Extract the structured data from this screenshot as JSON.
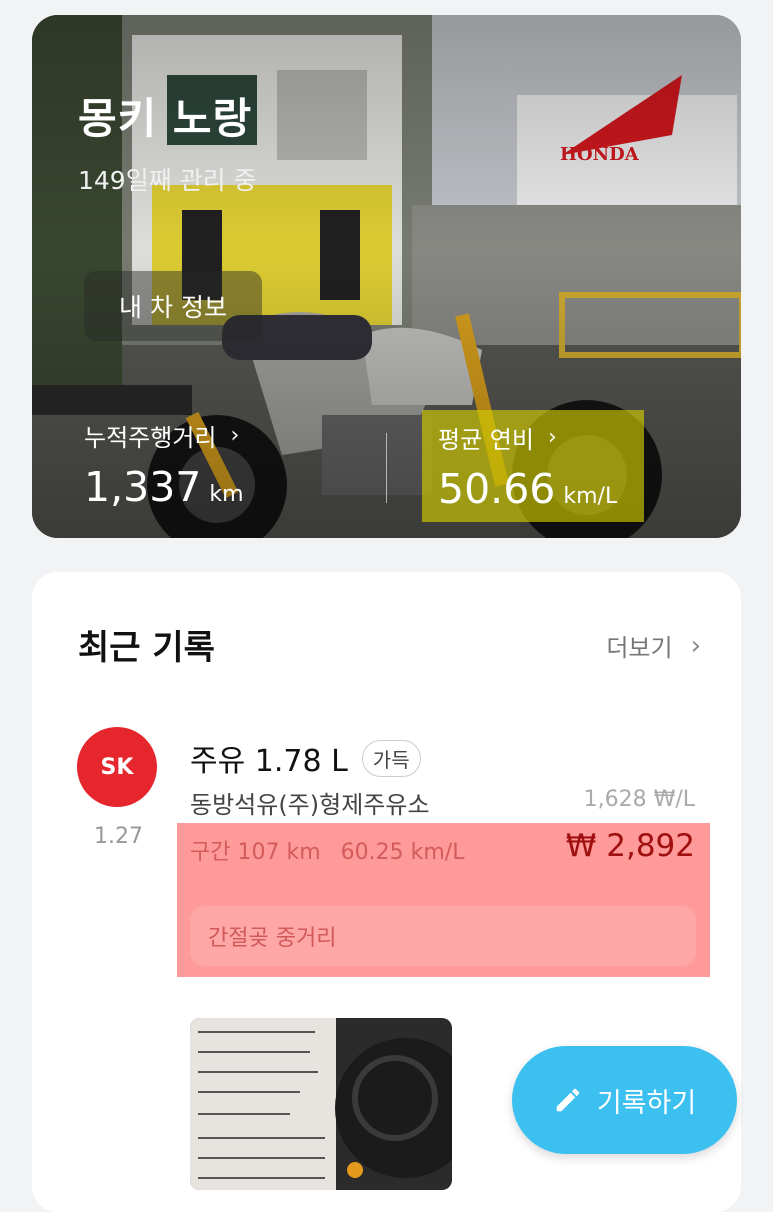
{
  "vehicle": {
    "name": "몽키 노랑",
    "days": "149일째 관리 중",
    "info_button": "내 차 정보",
    "odometer_label": "누적주행거리",
    "odometer_value": "1,337",
    "odometer_unit": "km",
    "efficiency_label": "평균 연비",
    "efficiency_value": "50.66",
    "efficiency_unit": "km/L",
    "brand_logo": "HONDA"
  },
  "recent": {
    "title": "최근 기록",
    "more_label": "더보기",
    "record": {
      "logo_text": "SK",
      "date": "1.27",
      "title": "주유 1.78 L",
      "badge": "가득",
      "station": "동방석유(주)형제주유소",
      "unit_price": "1,628 ₩/L",
      "segment_distance": "구간 107 km",
      "segment_efficiency": "60.25 km/L",
      "price": "₩ 2,892",
      "memo": "간절곶 중거리"
    }
  },
  "fab": {
    "label": "기록하기"
  }
}
